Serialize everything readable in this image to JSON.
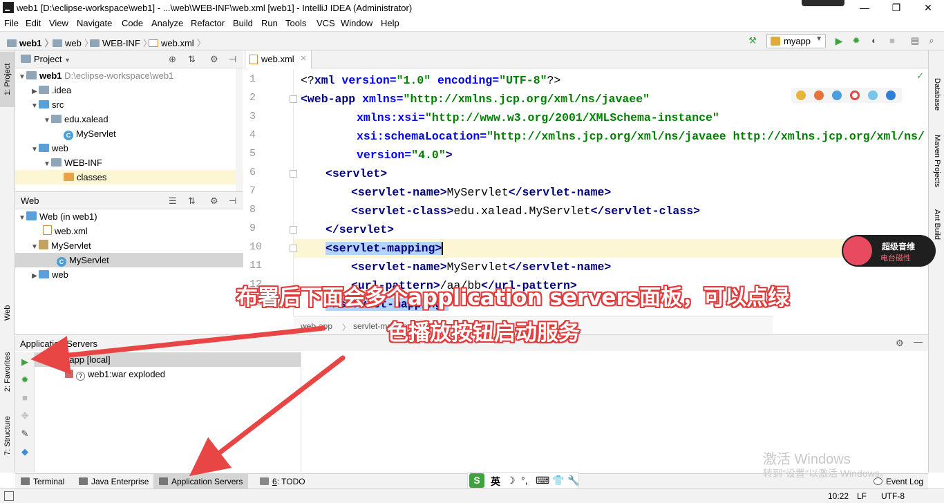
{
  "window": {
    "title": "web1 [D:\\eclipse-workspace\\web1] - ...\\web\\WEB-INF\\web.xml [web1] - IntelliJ IDEA (Administrator)",
    "minimize": "—",
    "maximize": "❐",
    "close": "✕"
  },
  "menu": [
    "File",
    "Edit",
    "View",
    "Navigate",
    "Code",
    "Analyze",
    "Refactor",
    "Build",
    "Run",
    "Tools",
    "VCS",
    "Window",
    "Help"
  ],
  "breadcrumb": [
    "web1",
    "web",
    "WEB-INF",
    "web.xml"
  ],
  "run_config": {
    "label": "myapp"
  },
  "left_stripe": {
    "project": "1: Project",
    "web": "Web",
    "favorites": "2: Favorites",
    "structure": "7: Structure"
  },
  "right_stripe": {
    "database": "Database",
    "maven": "Maven Projects",
    "ant": "Ant Build"
  },
  "project_panel": {
    "title": "Project",
    "tree": [
      {
        "label": "web1",
        "extra": "D:\\eclipse-workspace\\web1"
      },
      {
        "label": ".idea"
      },
      {
        "label": "src"
      },
      {
        "label": "edu.xalead"
      },
      {
        "label": "MyServlet"
      },
      {
        "label": "web"
      },
      {
        "label": "WEB-INF"
      },
      {
        "label": "classes"
      }
    ]
  },
  "web_panel": {
    "title": "Web",
    "tree": [
      {
        "label": "Web (in web1)"
      },
      {
        "label": "web.xml"
      },
      {
        "label": "MyServlet"
      },
      {
        "label": "MyServlet"
      },
      {
        "label": "web"
      }
    ]
  },
  "editor": {
    "tab": "web.xml",
    "line_numbers": [
      "1",
      "2",
      "3",
      "4",
      "5",
      "6",
      "7",
      "8",
      "9",
      "10",
      "11",
      "12",
      "13"
    ],
    "lines": {
      "l1_a": "<?",
      "l1_b": "xml ",
      "l1_c": "version=",
      "l1_d": "\"1.0\"",
      "l1_e": " encoding=",
      "l1_f": "\"UTF-8\"",
      "l1_g": "?>",
      "l2_a": "<web-app ",
      "l2_b": "xmlns=",
      "l2_c": "\"http://xmlns.jcp.org/xml/ns/javaee\"",
      "l3_a": "xmlns:xsi=",
      "l3_b": "\"http://www.w3.org/2001/XMLSchema-instance\"",
      "l4_a": "xsi:schemaLocation=",
      "l4_b": "\"http://xmlns.jcp.org/xml/ns/javaee http://xmlns.jcp.org/xml/ns/",
      "l5_a": "version=",
      "l5_b": "\"4.0\"",
      "l5_c": ">",
      "l6": "<servlet>",
      "l7_a": "<servlet-name>",
      "l7_b": "MyServlet",
      "l7_c": "</servlet-name>",
      "l8_a": "<servlet-class>",
      "l8_b": "edu.xalead.MyServlet",
      "l8_c": "</servlet-class>",
      "l9": "</servlet>",
      "l10": "<servlet-mapping>",
      "l11_a": "<servlet-name>",
      "l11_b": "MyServlet",
      "l11_c": "</servlet-name>",
      "l12_a": "<url-pattern>",
      "l12_b": "/aa/bb",
      "l12_c": "</url-pattern>",
      "l13": "</servlet-mapping>"
    },
    "crumbs": [
      "web-app",
      "servlet-mapping"
    ]
  },
  "app_servers": {
    "title": "Application Servers",
    "server": "myapp [local]",
    "artifact": "web1:war exploded"
  },
  "bottom_tabs": {
    "terminal": "Terminal",
    "java_enterprise": "Java Enterprise",
    "app_servers": "Application Servers",
    "todo_num": "6",
    "todo": ": TODO",
    "event_log": "Event Log"
  },
  "ime": {
    "lang": "英"
  },
  "status": {
    "time": "10:22",
    "line_sep": "LF",
    "encoding": "UTF-8"
  },
  "annotation": {
    "line1": "布署后下面会多个application servers面板，可以点绿",
    "line2": "色播放按钮启动服务"
  },
  "badge": {
    "title": "超级音维",
    "subtitle": "电台磁性"
  },
  "watermark": {
    "line1": "激活 Windows",
    "line2": "转到\"设置\"以激活 Windows。"
  },
  "colors": {
    "annotation_red": "#e84545",
    "run_green": "#3ea33e",
    "selection": "#b3d4fc",
    "current_line": "#fdf6d4"
  }
}
